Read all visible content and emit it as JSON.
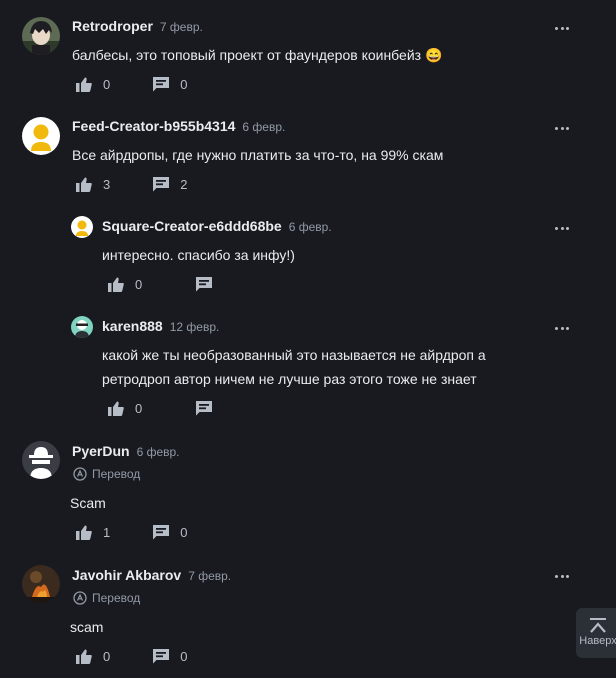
{
  "comments": [
    {
      "author": "Retrodroper",
      "date": "7 февр.",
      "text": "балбесы, это топовый проект от фаундеров коинбейз 😄",
      "likes": "0",
      "replies": "0"
    },
    {
      "author": "Feed-Creator-b955b4314",
      "date": "6 февр.",
      "text": "Все айрдропы, где нужно платить за что-то, на 99% скам",
      "likes": "3",
      "replies": "2"
    },
    {
      "author": "Square-Creator-e6ddd68be",
      "date": "6 февр.",
      "text": "интересно. спасибо за инфу!)",
      "likes": "0"
    },
    {
      "author": "karen888",
      "date": "12 февр.",
      "text_line1": "какой же ты необразованный это называется не айрдроп а",
      "text_line2": "ретродроп автор ничем не лучше раз этого тоже не знает",
      "likes": "0"
    },
    {
      "author": "PyerDun",
      "date": "6 февр.",
      "translate": "Перевод",
      "text": "Scam",
      "likes": "1",
      "replies": "0"
    },
    {
      "author": "Javohir Akbarov",
      "date": "7 февр.",
      "translate": "Перевод",
      "text": "scam",
      "likes": "0",
      "replies": "0"
    }
  ],
  "back_to_top": {
    "label": "Наверх"
  },
  "colors": {
    "background": "#181a20",
    "text_primary": "#eaecef",
    "text_secondary": "#929aa5",
    "icon": "#b7bdc6"
  },
  "icons": [
    "thumbs-up-icon",
    "comment-icon",
    "more-dots-icon",
    "translate-icon",
    "chevron-up-icon"
  ]
}
